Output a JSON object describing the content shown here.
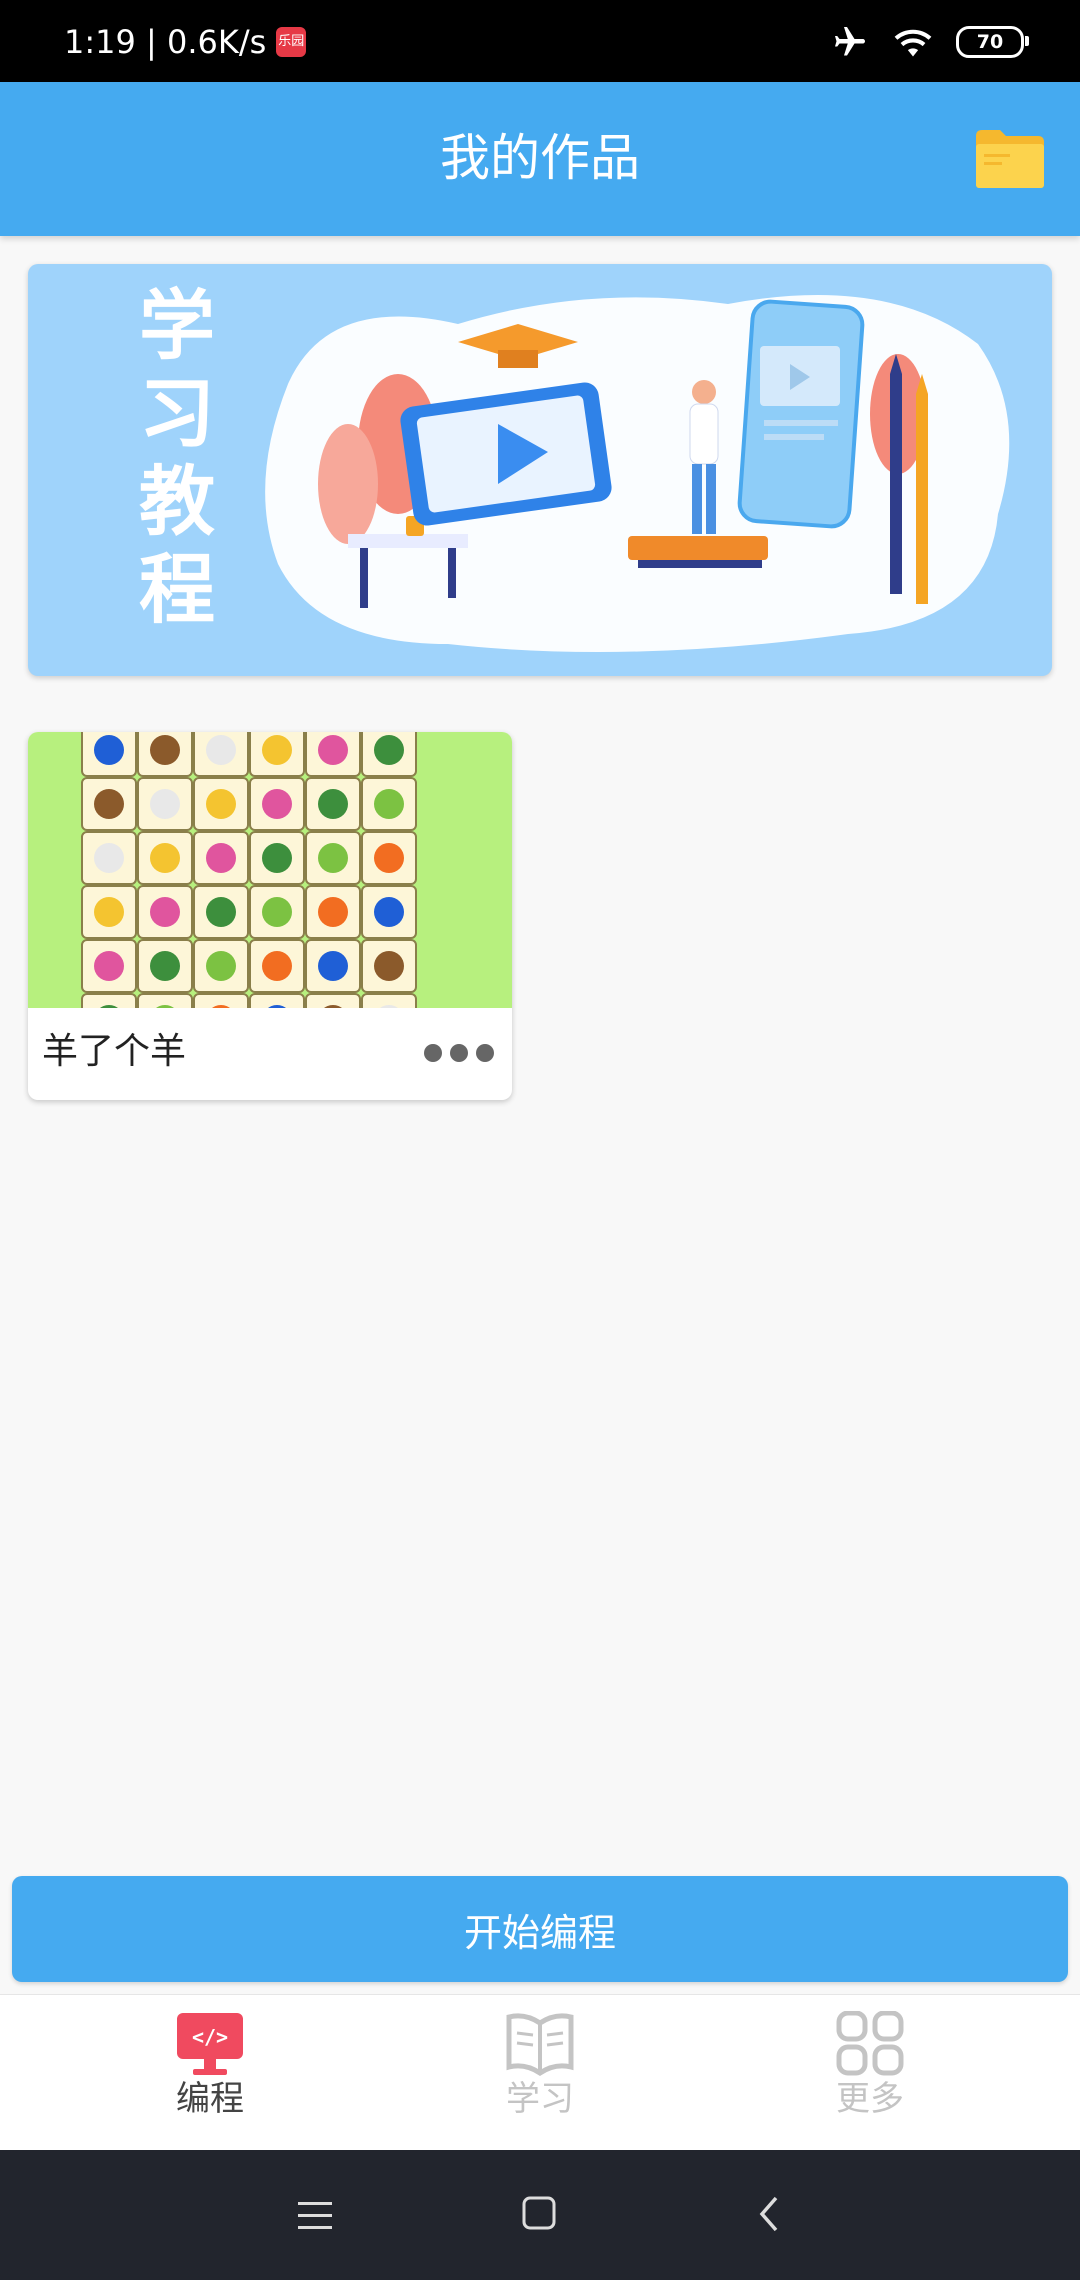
{
  "status_bar": {
    "time_speed": "1:19 | 0.6K/s",
    "app_icon_text": "乐园",
    "battery": "70",
    "icons": [
      "airplane-mode-icon",
      "wifi-icon",
      "battery-icon"
    ]
  },
  "app_bar": {
    "title": "我的作品",
    "folder_icon": "folder-icon"
  },
  "banner": {
    "text": "学习教程",
    "illustration": "tutorial-video-illustration"
  },
  "works": [
    {
      "title": "羊了个羊",
      "thumbnail": "tile-match-game-thumbnail",
      "menu_icon": "more-dots-icon"
    }
  ],
  "start_button": {
    "label": "开始编程"
  },
  "bottom_nav": [
    {
      "label": "编程",
      "icon": "code-monitor-icon",
      "active": true
    },
    {
      "label": "学习",
      "icon": "book-icon",
      "active": false
    },
    {
      "label": "更多",
      "icon": "grid-icon",
      "active": false
    }
  ],
  "colors": {
    "primary": "#45aaf0",
    "active_tab": "#f04a5f",
    "inactive_tab": "#c4c4c4",
    "page_bg": "#f8f8f8"
  }
}
